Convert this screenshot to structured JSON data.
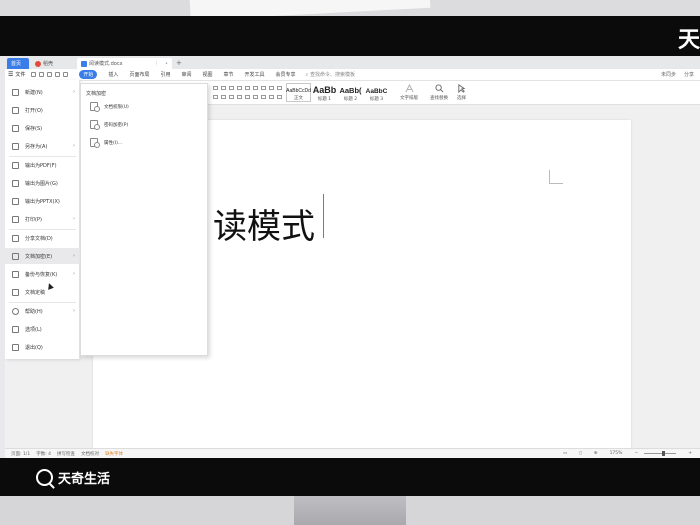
{
  "title_tabs": {
    "home": "首页",
    "straw": "稻壳",
    "doc": "阅读模式.docx",
    "new_tab": "+"
  },
  "menubar": {
    "file": "文件",
    "items": [
      "开始",
      "插入",
      "页面布局",
      "引用",
      "审阅",
      "视图",
      "章节",
      "开发工具",
      "会员专享"
    ],
    "active_index": 0,
    "search": "查找命令、搜索模板",
    "collab": "未同步",
    "share": "分享"
  },
  "ribbon": {
    "styles": [
      {
        "sample": "AaBbCcDd",
        "label": "正文"
      },
      {
        "sample": "AaBb",
        "label": "标题 1"
      },
      {
        "sample": "AaBb(",
        "label": "标题 2"
      },
      {
        "sample": "AaBbC",
        "label": "标题 3"
      }
    ],
    "text_tool": "文字排版",
    "find_replace": "查找替换",
    "select": "选择"
  },
  "document": {
    "text": "读模式"
  },
  "file_menu": {
    "items": [
      {
        "label": "新建(N)",
        "has_arrow": true
      },
      {
        "label": "打开(O)",
        "has_arrow": false
      },
      {
        "label": "保存(S)",
        "has_arrow": false
      },
      {
        "label": "另存为(A)",
        "has_arrow": true
      },
      {
        "label": "输出为PDF(F)",
        "has_arrow": false
      },
      {
        "label": "输出为图片(G)",
        "has_arrow": false
      },
      {
        "label": "输出为PPTX(X)",
        "has_arrow": false
      },
      {
        "label": "打印(P)",
        "has_arrow": true
      },
      {
        "label": "分享文档(D)",
        "has_arrow": false
      },
      {
        "label": "文档加密(E)",
        "has_arrow": true
      },
      {
        "label": "备份与恢复(K)",
        "has_arrow": true
      },
      {
        "label": "文档定稿",
        "has_arrow": false
      },
      {
        "label": "帮助(H)",
        "has_arrow": true
      },
      {
        "label": "选项(L)",
        "has_arrow": false
      },
      {
        "label": "退出(Q)",
        "has_arrow": false
      }
    ],
    "highlighted_index": 9
  },
  "submenu": {
    "title": "文档加密",
    "items": [
      "文档权限(U)",
      "密码加密(P)",
      "属性(I)..."
    ]
  },
  "statusbar": {
    "page": "页面: 1/1",
    "words": "字数: 4",
    "spell": "拼写检查",
    "proof": "文档校对",
    "warn": "缺失字体",
    "zoom": "175%"
  },
  "watermark": {
    "corner": "天",
    "brand": "天奇生活"
  }
}
